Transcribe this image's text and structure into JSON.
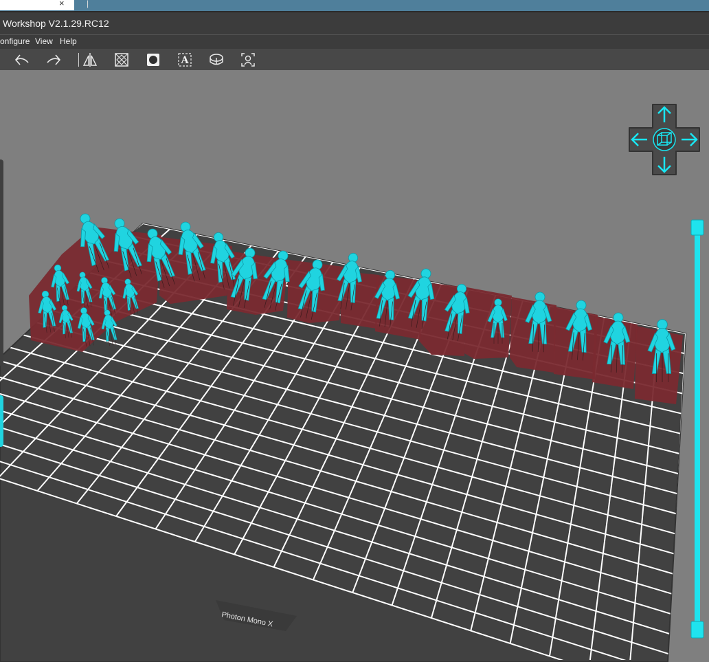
{
  "window": {
    "title": "Workshop V2.1.29.RC12"
  },
  "browser_tab": {
    "close_glyph": "×"
  },
  "menu": {
    "items": [
      "onfigure",
      "View",
      "Help"
    ]
  },
  "toolbar": {
    "tools": [
      "undo-icon",
      "redo-icon",
      "mirror-icon",
      "hollow-icon",
      "punch-hole-icon",
      "text-icon",
      "slice-icon",
      "auto-support-icon"
    ]
  },
  "viewport": {
    "printer_label": "Photon Mono X",
    "colors": {
      "background": "#7f7f7f",
      "build_plate": "#414141",
      "grid_lines": "#ffffff",
      "model": "#20d4e0",
      "support_base": "#7a2a30"
    },
    "nav_cube_icons": [
      "arrow-up-icon",
      "arrow-left-icon",
      "cube-icon",
      "arrow-right-icon",
      "arrow-down-icon"
    ]
  },
  "layer_slider": {
    "accent_color": "#1fe3ee"
  }
}
